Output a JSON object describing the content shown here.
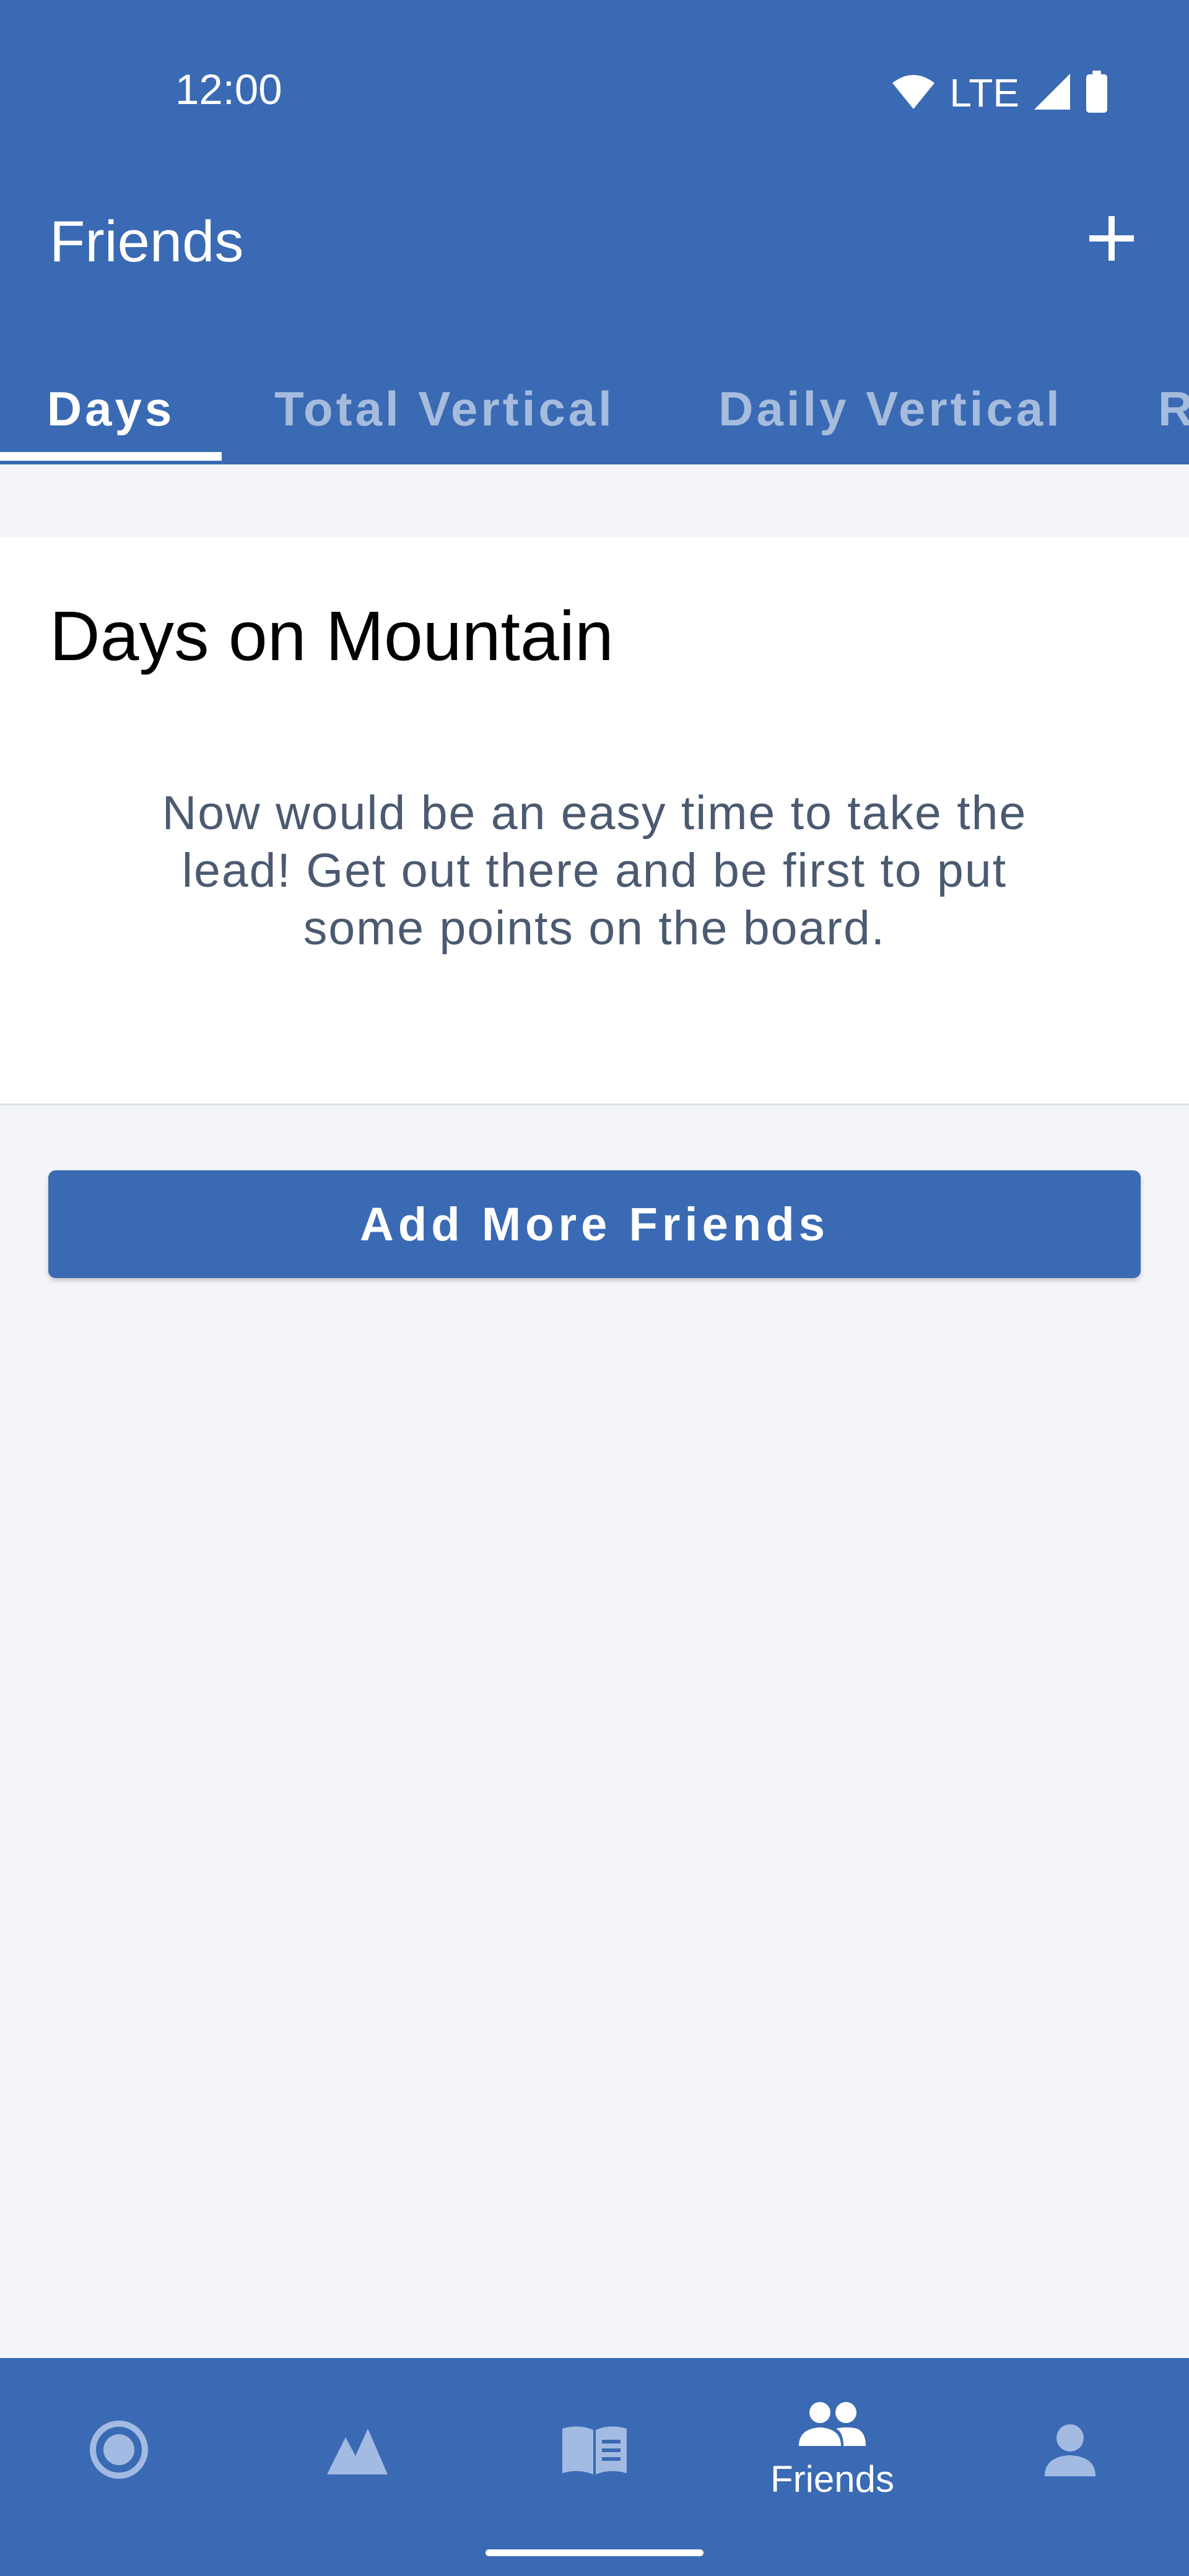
{
  "status_bar": {
    "time": "12:00",
    "network": "LTE",
    "icons": [
      "wifi-icon",
      "cell-signal-icon",
      "battery-icon"
    ]
  },
  "toolbar": {
    "title": "Friends",
    "action_icon": "plus-icon"
  },
  "tabs": [
    {
      "label": "Days",
      "active": true
    },
    {
      "label": "Total Vertical",
      "active": false
    },
    {
      "label": "Daily Vertical",
      "active": false
    },
    {
      "label": "R",
      "active": false
    }
  ],
  "card": {
    "title": "Days on Mountain",
    "message": "Now would be an easy time to take the lead! Get out there and be first to put some points on the board."
  },
  "add_friends_button": "Add More Friends",
  "bottom_nav": [
    {
      "icon": "record-icon",
      "label": "",
      "active": false
    },
    {
      "icon": "mountain-icon",
      "label": "",
      "active": false
    },
    {
      "icon": "guide-book-icon",
      "label": "",
      "active": false
    },
    {
      "icon": "friends-icon",
      "label": "Friends",
      "active": true
    },
    {
      "icon": "profile-icon",
      "label": "",
      "active": false
    }
  ],
  "colors": {
    "primary": "#3a6ab4",
    "background": "#f4f5f9",
    "card": "#ffffff",
    "message_text": "#4b5a70",
    "inactive_icon": "#a3bbe2"
  }
}
